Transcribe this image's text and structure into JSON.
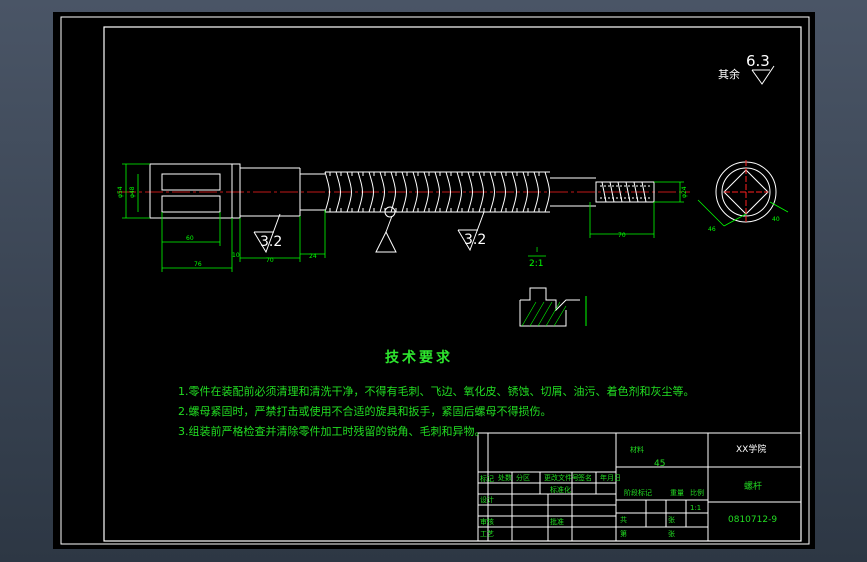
{
  "drawing": {
    "roughness_symbol": {
      "prefix": "其余",
      "value": "6.3"
    },
    "surface_finish": [
      "3.2",
      "3.2"
    ],
    "detail_view": {
      "ref": "I",
      "scale": "2:1"
    },
    "dims": {
      "left_dia_1": "φ54",
      "left_dia_2": "φ48",
      "len_60": "60",
      "len_76": "76",
      "len_10": "10",
      "len_70_a": "70",
      "len_24": "24",
      "right_len_70": "70",
      "right_dia": "φ24",
      "hex_across_a": "46",
      "hex_across_b": "40"
    }
  },
  "tech_requirements": {
    "title": "技术要求",
    "items": [
      "1.零件在装配前必须清理和清洗干净，不得有毛刺、飞边、氧化皮、锈蚀、切屑、油污、着色剂和灰尘等。",
      "2.螺母紧固时，严禁打击或使用不合适的旋具和扳手，紧固后螺母不得损伤。",
      "3.组装前严格检查并清除零件加工时残留的锐角、毛刺和异物。"
    ]
  },
  "title_block": {
    "material_label": "材料",
    "material": "45",
    "school": "XX学院",
    "part_name": "螺杆",
    "drawing_no": "0810712-9",
    "scale": "1:1",
    "labels": [
      "标记",
      "处数",
      "分区",
      "更改文件号",
      "签名",
      "年月日",
      "设计",
      "标准化",
      "阶段标记",
      "重量",
      "比例",
      "审核",
      "工艺",
      "批准",
      "共",
      "张",
      "第",
      "张"
    ]
  },
  "colors": {
    "background": "#000000",
    "frame": "#ffffff",
    "dimension": "#00ff00",
    "centerline": "#ff0000",
    "text": "#22dd22"
  }
}
